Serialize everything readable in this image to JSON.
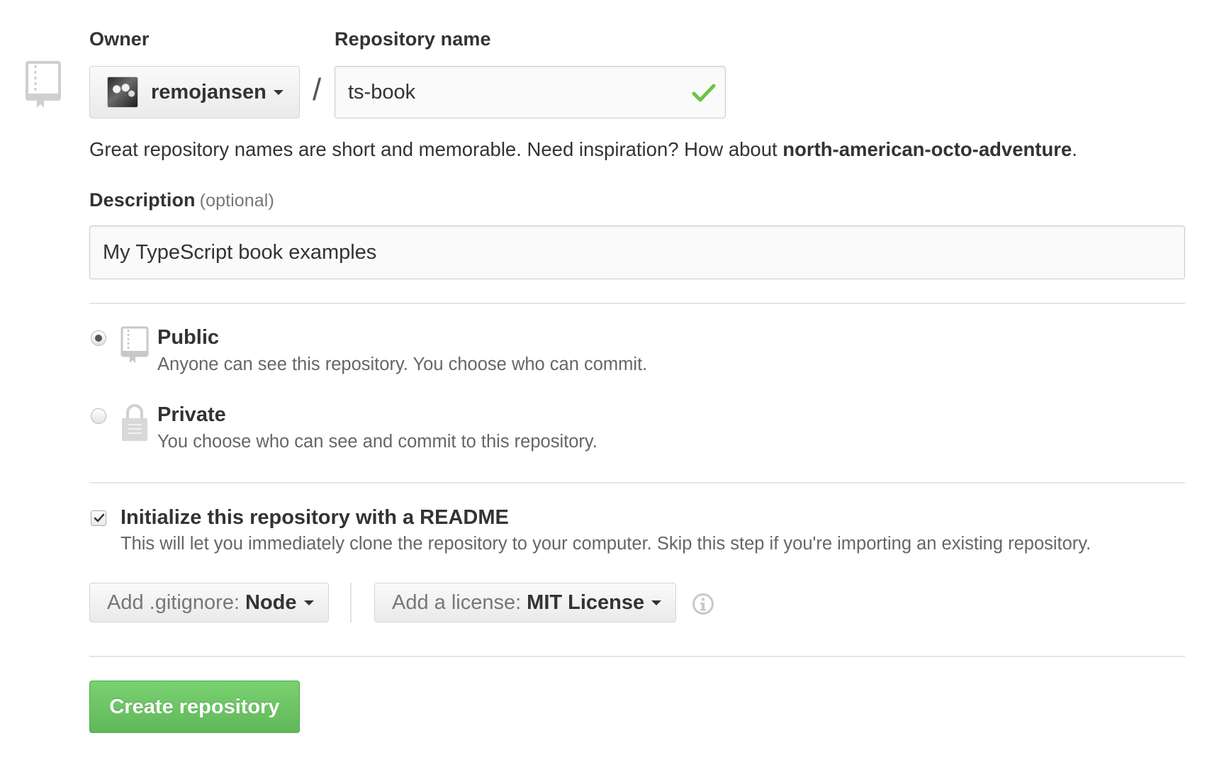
{
  "owner": {
    "label": "Owner",
    "selected": "remojansen"
  },
  "repository_name": {
    "label": "Repository name",
    "value": "ts-book",
    "valid": true
  },
  "name_hint": {
    "text": "Great repository names are short and memorable. Need inspiration? How about ",
    "suggestion": "north-american-octo-adventure",
    "suffix": "."
  },
  "description": {
    "label": "Description",
    "optional_label": "(optional)",
    "value": "My TypeScript book examples"
  },
  "visibility": {
    "selected": "public",
    "options": [
      {
        "id": "public",
        "title": "Public",
        "description": "Anyone can see this repository. You choose who can commit.",
        "icon": "repo-icon"
      },
      {
        "id": "private",
        "title": "Private",
        "description": "You choose who can see and commit to this repository.",
        "icon": "lock-icon"
      }
    ]
  },
  "readme": {
    "checked": true,
    "title": "Initialize this repository with a README",
    "description": "This will let you immediately clone the repository to your computer. Skip this step if you're importing an existing repository."
  },
  "gitignore": {
    "prefix": "Add .gitignore:",
    "value": "Node"
  },
  "license": {
    "prefix": "Add a license:",
    "value": "MIT License"
  },
  "submit": {
    "label": "Create repository"
  },
  "colors": {
    "success_green": "#6cc644",
    "button_green": "#60b85a",
    "text": "#333333",
    "muted_text": "#666666",
    "border": "#d5d5d5"
  }
}
